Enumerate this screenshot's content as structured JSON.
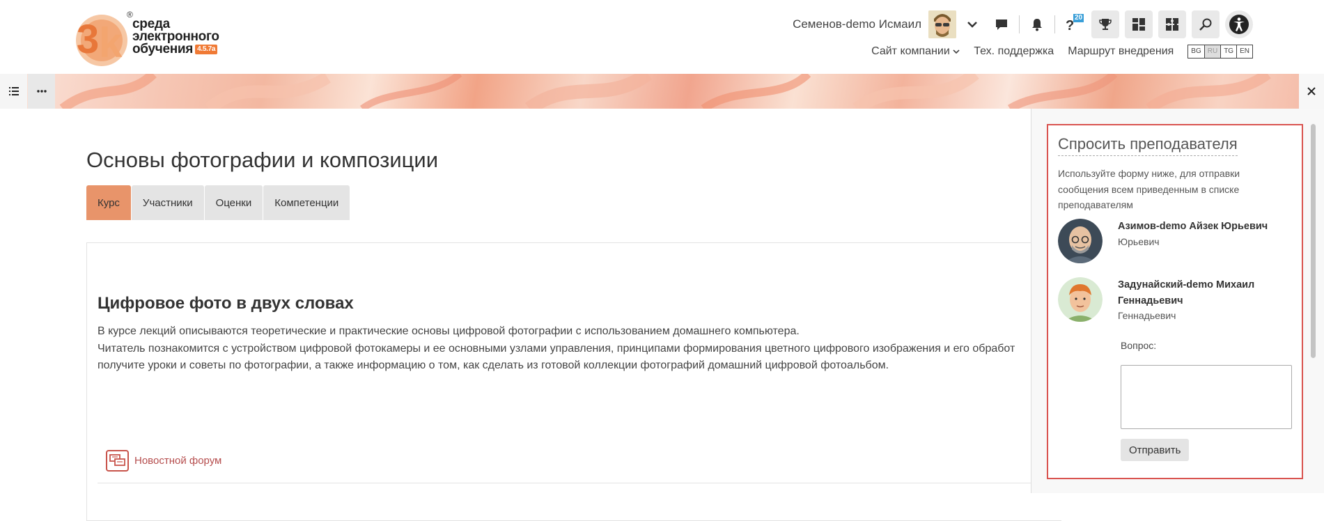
{
  "brand": {
    "logo_mark": "3k",
    "logo_line1": "среда",
    "logo_line2": "электронного",
    "logo_line3": "обучения",
    "version": "4.5.7a",
    "registered": "®"
  },
  "user": {
    "name": "Семенов-demo Исмаил"
  },
  "toolbar": {
    "badge_count": "20",
    "icons": [
      "chevron-down-icon",
      "chat-icon",
      "bell-icon",
      "help-icon",
      "trophy-icon",
      "dashboard-icon",
      "puzzle-icon",
      "search-icon",
      "accessibility-icon"
    ]
  },
  "nav_links": {
    "company_site": "Сайт компании",
    "support": "Тех. поддержка",
    "route": "Маршрут внедрения"
  },
  "languages": [
    {
      "code": "BG",
      "active": false
    },
    {
      "code": "RU",
      "active": true
    },
    {
      "code": "TG",
      "active": false
    },
    {
      "code": "EN",
      "active": false
    }
  ],
  "page": {
    "title": "Основы фотографии и композиции"
  },
  "tabs": [
    {
      "label": "Курс",
      "active": true
    },
    {
      "label": "Участники",
      "active": false
    },
    {
      "label": "Оценки",
      "active": false
    },
    {
      "label": "Компетенции",
      "active": false
    }
  ],
  "section": {
    "title": "Цифровое фото в двух словах",
    "line1": "В курсе лекций описываются теоретические и практические основы цифровой фотографии с использованием домашнего компьютера.",
    "line2": "Читатель познакомится с устройством цифровой фотокамеры и ее основными узлами управления, принципами формирования цветного цифрового изображения и его обработ",
    "line3": "получите уроки и советы по фотографии, а также информацию о том, как сделать из готовой коллекции фотографий домашний цифровой фотоальбом.",
    "forum_label": "Новостной форум"
  },
  "ask_teacher": {
    "title": "Спросить преподавателя",
    "description": "Используйте форму ниже, для отправки сообщения всем приведенным в списке преподавателям",
    "teachers": [
      {
        "name": "Азимов-demo Айзек Юрьевич",
        "subtitle": "Юрьевич"
      },
      {
        "name": "Задунайский-demo Михаил Геннадьевич",
        "subtitle": "Геннадьевич"
      }
    ],
    "question_label": "Вопрос:",
    "question_value": "",
    "send_label": "Отправить"
  },
  "colors": {
    "accent": "#e8946a",
    "ask_border": "#d9534f",
    "forum_link": "#b54d4d",
    "logo_orange": "#f07a35"
  }
}
